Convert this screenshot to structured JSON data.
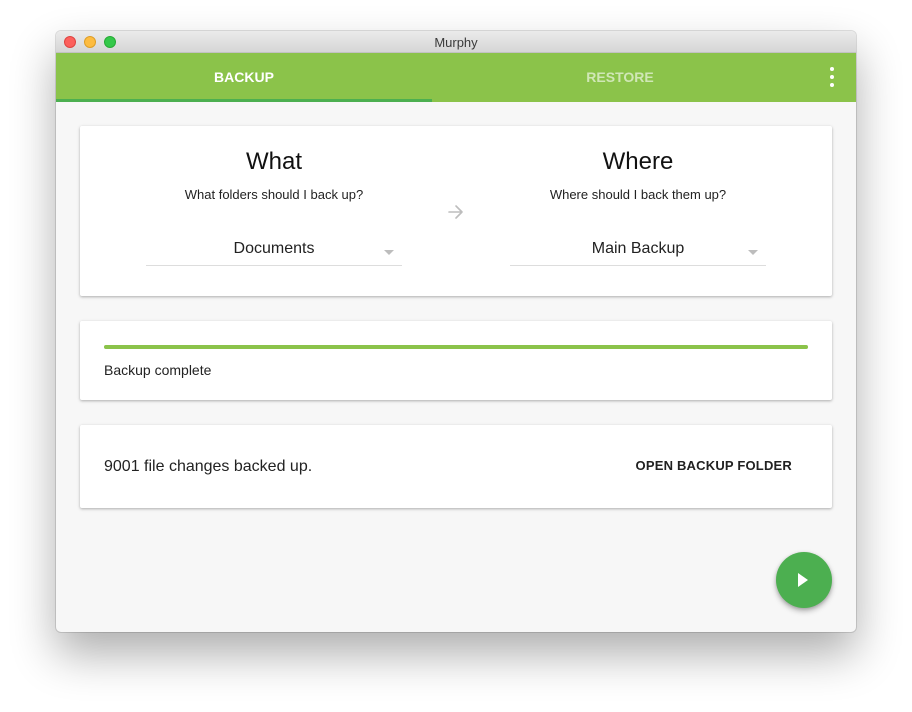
{
  "window": {
    "title": "Murphy"
  },
  "tabs": [
    {
      "label": "BACKUP",
      "active": true
    },
    {
      "label": "RESTORE",
      "active": false
    }
  ],
  "icons": {
    "menu": "more-vert-icon",
    "arrow": "arrow-right-icon",
    "fab": "play-icon"
  },
  "colors": {
    "primary": "#8bc34a",
    "accent": "#4caf50",
    "tab_inactive": "rgba(255,255,255,0.6)"
  },
  "what": {
    "title": "What",
    "subtitle": "What folders should I back up?",
    "selected": "Documents"
  },
  "where": {
    "title": "Where",
    "subtitle": "Where should I back them up?",
    "selected": "Main Backup"
  },
  "progress": {
    "value_percent": 100,
    "label": "Backup complete"
  },
  "result": {
    "message": "9001 file changes backed up.",
    "open_folder_label": "OPEN BACKUP FOLDER"
  }
}
